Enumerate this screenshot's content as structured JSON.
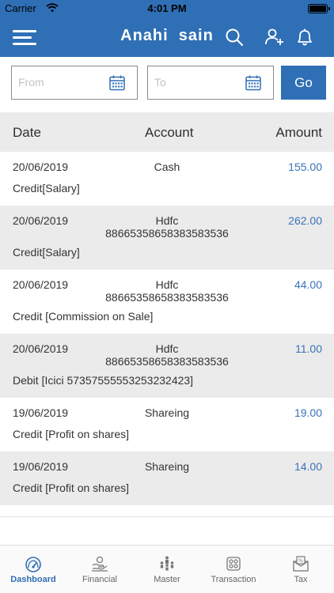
{
  "status": {
    "carrier": "Carrier",
    "time": "4:01 PM"
  },
  "header": {
    "title": "Anahi  sain"
  },
  "filter": {
    "from_placeholder": "From",
    "to_placeholder": "To",
    "go_label": "Go"
  },
  "table": {
    "columns": {
      "date": "Date",
      "account": "Account",
      "amount": "Amount"
    },
    "rows": [
      {
        "date": "20/06/2019",
        "account": "Cash",
        "account_no": "",
        "amount": "155.00",
        "description": "Credit[Salary]"
      },
      {
        "date": "20/06/2019",
        "account": "Hdfc",
        "account_no": "88665358658383583536",
        "amount": "262.00",
        "description": "Credit[Salary]"
      },
      {
        "date": "20/06/2019",
        "account": "Hdfc",
        "account_no": "88665358658383583536",
        "amount": "44.00",
        "description": "Credit [Commission on Sale]"
      },
      {
        "date": "20/06/2019",
        "account": "Hdfc",
        "account_no": "88665358658383583536",
        "amount": "11.00",
        "description": "Debit [Icici 57357555553253232423]"
      },
      {
        "date": "19/06/2019",
        "account": "Shareing",
        "account_no": "",
        "amount": "19.00",
        "description": "Credit [Profit on shares]"
      },
      {
        "date": "19/06/2019",
        "account": "Shareing",
        "account_no": "",
        "amount": "14.00",
        "description": "Credit [Profit on shares]"
      }
    ]
  },
  "tabs": [
    {
      "label": "Dashboard",
      "icon": "dashboard-icon",
      "active": true
    },
    {
      "label": "Financial",
      "icon": "financial-icon",
      "active": false
    },
    {
      "label": "Master",
      "icon": "master-icon",
      "active": false
    },
    {
      "label": "Transaction",
      "icon": "transaction-icon",
      "active": false
    },
    {
      "label": "Tax",
      "icon": "tax-icon",
      "active": false
    }
  ],
  "colors": {
    "primary": "#2f6fb5",
    "amount": "#3a72b8",
    "row_shade": "#ebebeb"
  }
}
